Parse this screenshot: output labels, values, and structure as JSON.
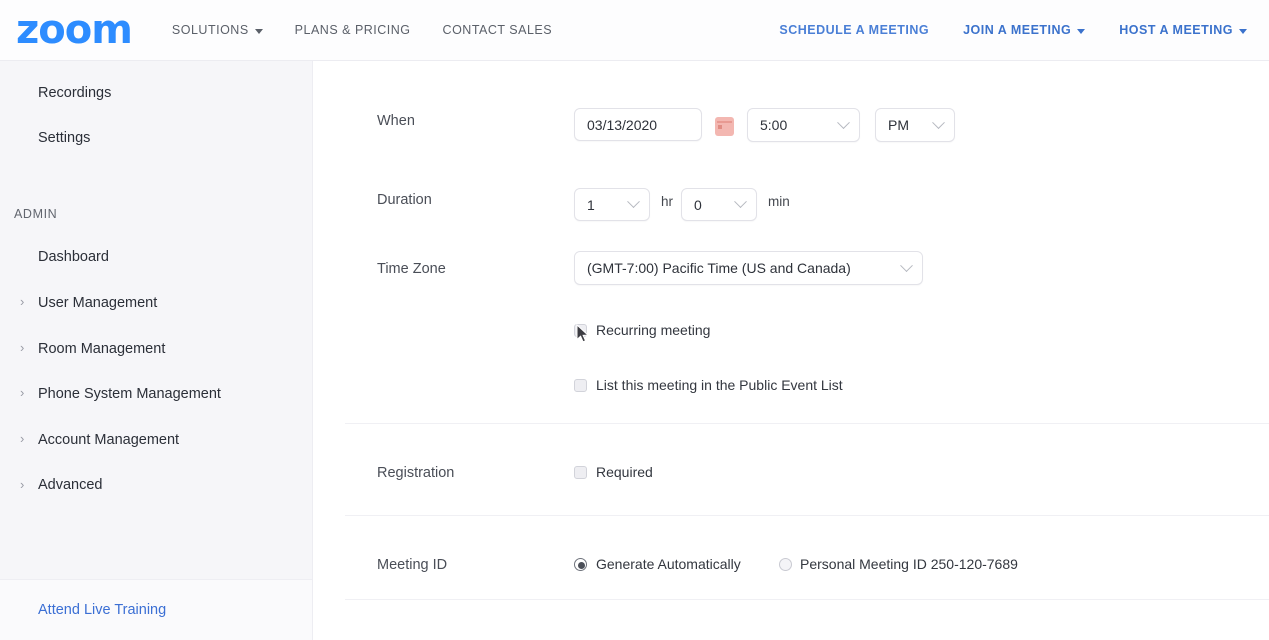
{
  "topnav": {
    "brand": "zoom",
    "left_items": [
      {
        "label": "SOLUTIONS",
        "has_caret": true
      },
      {
        "label": "PLANS & PRICING",
        "has_caret": false
      },
      {
        "label": "CONTACT SALES",
        "has_caret": false
      }
    ],
    "right_items": [
      {
        "label": "SCHEDULE A MEETING",
        "has_caret": false
      },
      {
        "label": "JOIN A MEETING",
        "has_caret": true
      },
      {
        "label": "HOST A MEETING",
        "has_caret": true
      }
    ]
  },
  "sidebar": {
    "top_items": [
      {
        "label": "Recordings",
        "has_chevron": false
      },
      {
        "label": "Settings",
        "has_chevron": false
      }
    ],
    "section_label": "ADMIN",
    "admin_items": [
      {
        "label": "Dashboard",
        "has_chevron": false
      },
      {
        "label": "User Management",
        "has_chevron": true
      },
      {
        "label": "Room Management",
        "has_chevron": true
      },
      {
        "label": "Phone System Management",
        "has_chevron": true
      },
      {
        "label": "Account Management",
        "has_chevron": true
      },
      {
        "label": "Advanced",
        "has_chevron": true
      }
    ],
    "chevron_glyph": "›",
    "footer_link": "Attend Live Training"
  },
  "form": {
    "when": {
      "label": "When",
      "date_value": "03/13/2020",
      "calendar_icon": "calendar-icon",
      "time_value": "5:00",
      "meridiem_value": "PM"
    },
    "duration": {
      "label": "Duration",
      "hours_value": "1",
      "hours_unit": "hr",
      "minutes_value": "0",
      "minutes_unit": "min"
    },
    "timezone": {
      "label": "Time Zone",
      "value": "(GMT-7:00) Pacific Time (US and Canada)"
    },
    "recurring": {
      "label": "Recurring meeting",
      "checked": false
    },
    "public_event": {
      "label": "List this meeting in the Public Event List",
      "checked": false
    },
    "registration": {
      "label": "Registration",
      "option_label": "Required",
      "checked": false
    },
    "meeting_id": {
      "label": "Meeting ID",
      "options": [
        {
          "label": "Generate Automatically",
          "selected": true
        },
        {
          "label": "Personal Meeting ID 250-120-7689",
          "selected": false
        }
      ]
    }
  },
  "colors": {
    "brand_blue": "#2d8cff",
    "link_blue": "#3b6fd4",
    "nav_gray": "#5b6069",
    "sidebar_bg": "#f6f6f9",
    "calendar_icon": "#f3b7b1"
  }
}
